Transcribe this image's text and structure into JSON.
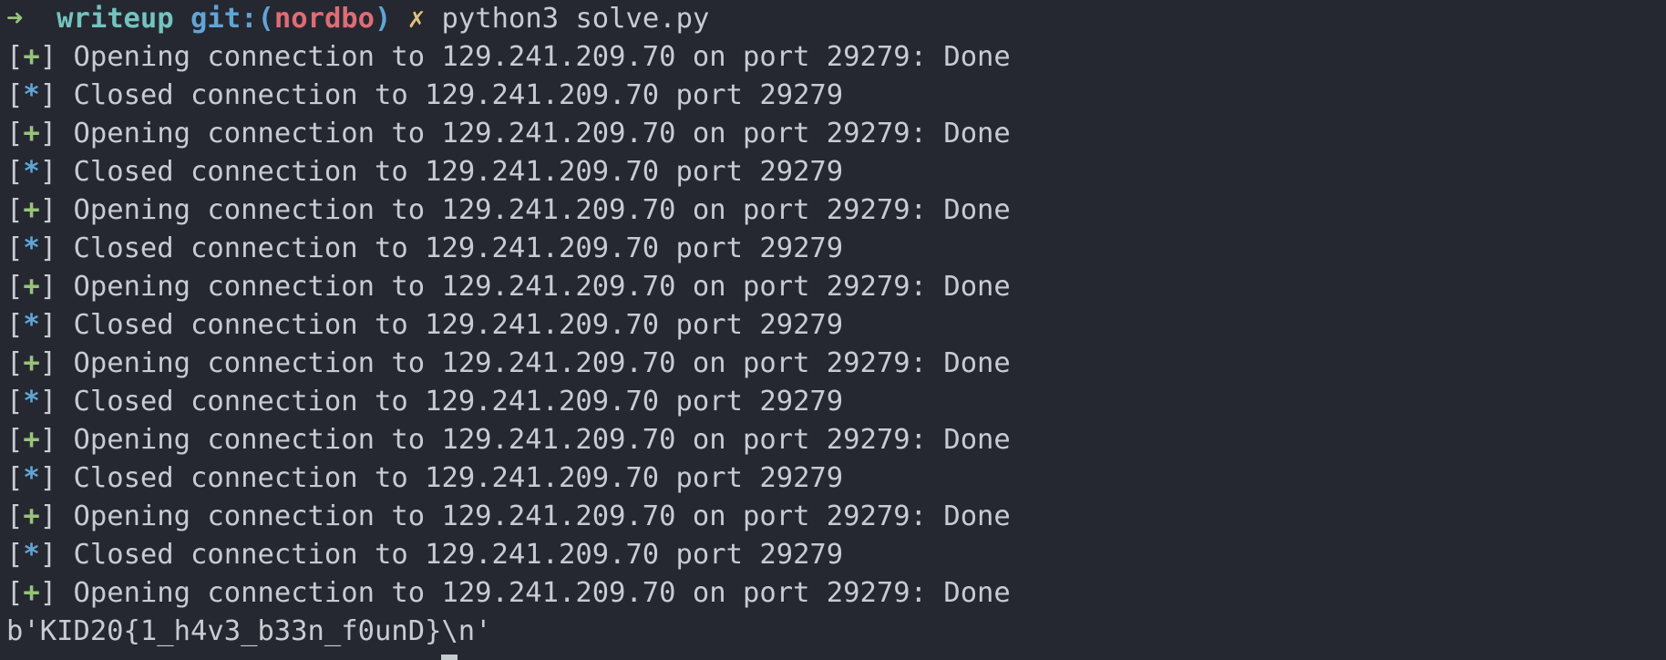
{
  "prompt": {
    "arrow": "➜",
    "dir": "writeup",
    "git_label": "git:(",
    "branch": "nordbo",
    "git_close": ")",
    "dirty": "✗",
    "command": "python3 solve.py"
  },
  "log": [
    {
      "marker": "+",
      "text": "Opening connection to 129.241.209.70 on port 29279: Done"
    },
    {
      "marker": "*",
      "text": "Closed connection to 129.241.209.70 port 29279"
    },
    {
      "marker": "+",
      "text": "Opening connection to 129.241.209.70 on port 29279: Done"
    },
    {
      "marker": "*",
      "text": "Closed connection to 129.241.209.70 port 29279"
    },
    {
      "marker": "+",
      "text": "Opening connection to 129.241.209.70 on port 29279: Done"
    },
    {
      "marker": "*",
      "text": "Closed connection to 129.241.209.70 port 29279"
    },
    {
      "marker": "+",
      "text": "Opening connection to 129.241.209.70 on port 29279: Done"
    },
    {
      "marker": "*",
      "text": "Closed connection to 129.241.209.70 port 29279"
    },
    {
      "marker": "+",
      "text": "Opening connection to 129.241.209.70 on port 29279: Done"
    },
    {
      "marker": "*",
      "text": "Closed connection to 129.241.209.70 port 29279"
    },
    {
      "marker": "+",
      "text": "Opening connection to 129.241.209.70 on port 29279: Done"
    },
    {
      "marker": "*",
      "text": "Closed connection to 129.241.209.70 port 29279"
    },
    {
      "marker": "+",
      "text": "Opening connection to 129.241.209.70 on port 29279: Done"
    },
    {
      "marker": "*",
      "text": "Closed connection to 129.241.209.70 port 29279"
    },
    {
      "marker": "+",
      "text": "Opening connection to 129.241.209.70 on port 29279: Done"
    }
  ],
  "flag_output": "b'KID20{1_h4v3_b33n_f0unD}\\n'",
  "colors": {
    "background": "#252831",
    "plus": "#98c379",
    "star": "#61a5d6",
    "branch": "#e06c75",
    "dir": "#74c3bf"
  }
}
